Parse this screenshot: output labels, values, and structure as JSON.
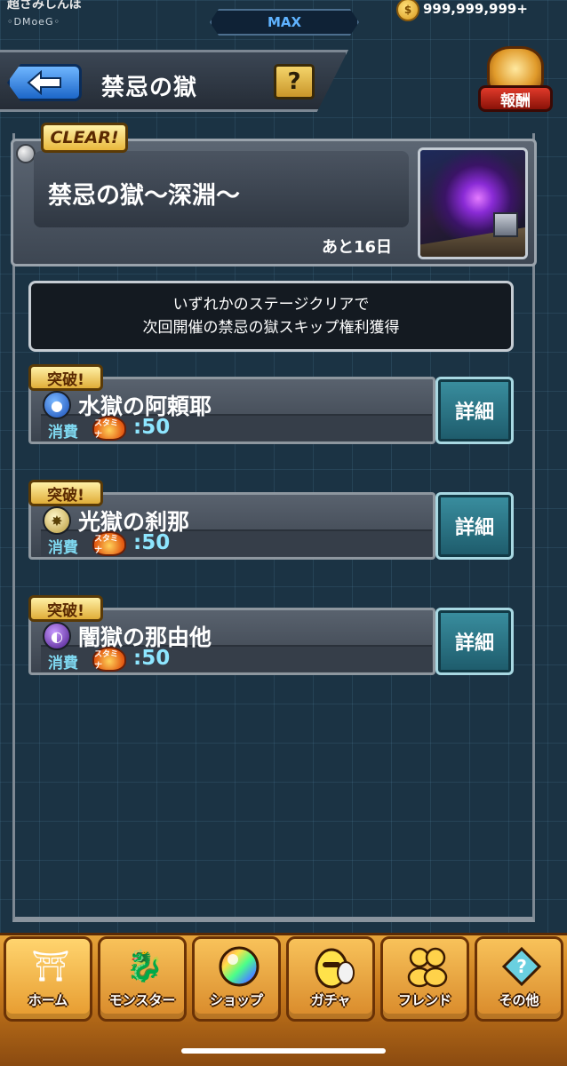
{
  "status": {
    "player_name": "超さみしんぼ",
    "player_tag": "◦DMoeG◦",
    "rank_label": "MAX",
    "coins": "999,999,999+"
  },
  "header": {
    "title": "禁忌の獄",
    "help_label": "?",
    "reward_label": "報酬"
  },
  "dungeon": {
    "clear_badge": "CLEAR!",
    "title": "禁忌の獄～深淵～",
    "remaining": "あと16日"
  },
  "info": {
    "line1": "いずれかのステージクリアで",
    "line2": "次回開催の禁忌の獄スキップ権利獲得"
  },
  "stages": [
    {
      "badge": "突破!",
      "name": "水獄の阿頼耶",
      "cost_label": "消費",
      "stamina_icon_text": "スタミナ",
      "cost": ":50",
      "detail_label": "詳細",
      "attribute": "water-icon"
    },
    {
      "badge": "突破!",
      "name": "光獄の刹那",
      "cost_label": "消費",
      "stamina_icon_text": "スタミナ",
      "cost": ":50",
      "detail_label": "詳細",
      "attribute": "light-icon"
    },
    {
      "badge": "突破!",
      "name": "闇獄の那由他",
      "cost_label": "消費",
      "stamina_icon_text": "スタミナ",
      "cost": ":50",
      "detail_label": "詳細",
      "attribute": "dark-icon"
    }
  ],
  "nav": [
    {
      "label": "ホーム",
      "icon": "home-gate-icon"
    },
    {
      "label": "モンスター",
      "icon": "monster-icon"
    },
    {
      "label": "ショップ",
      "icon": "orb-icon"
    },
    {
      "label": "ガチャ",
      "icon": "egg-icon"
    },
    {
      "label": "フレンド",
      "icon": "friend-icon"
    },
    {
      "label": "その他",
      "icon": "other-icon"
    }
  ]
}
